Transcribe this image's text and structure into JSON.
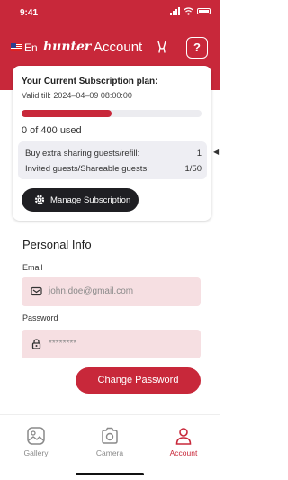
{
  "status_bar": {
    "time": "9:41"
  },
  "header": {
    "language": "En",
    "brand": "hunter",
    "title": "Account",
    "help_label": "?"
  },
  "subscription": {
    "title": "Your Current Subscription plan:",
    "valid_till": "Valid till:  2024–04–09 08:00:00",
    "used_fraction": 0.5,
    "usage_text": "0 of 400 used",
    "rows": [
      {
        "label": "Buy extra sharing guests/refill:",
        "value": "1"
      },
      {
        "label": "Invited guests/Shareable guests:",
        "value": "1/50"
      }
    ],
    "manage_label": "Manage Subscription"
  },
  "personal_info": {
    "title": "Personal Info",
    "email_label": "Email",
    "email_value": "john.doe@gmail.com",
    "password_label": "Password",
    "password_value": "********",
    "change_password_label": "Change Password"
  },
  "tabs": [
    {
      "label": "Gallery",
      "icon": "gallery-icon",
      "active": false
    },
    {
      "label": "Camera",
      "icon": "camera-icon",
      "active": false
    },
    {
      "label": "Account",
      "icon": "account-icon",
      "active": true
    }
  ],
  "colors": {
    "accent": "#c8283a",
    "field_bg": "#f6dfe2",
    "inactive_tab": "#8a8a8a",
    "dark_button": "#1f1f23"
  }
}
